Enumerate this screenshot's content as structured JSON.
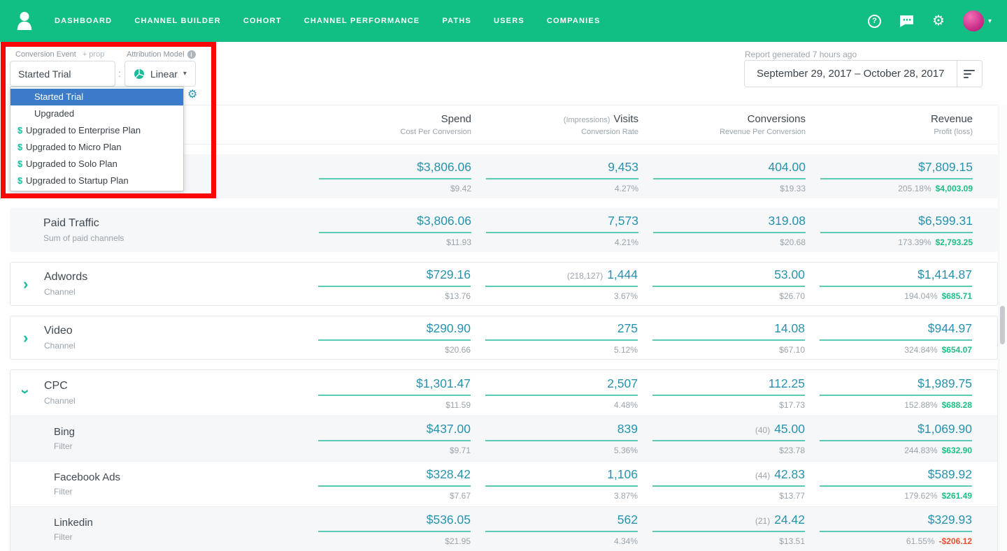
{
  "colors": {
    "nav_green": "#11BE83",
    "value_teal": "#2892AE",
    "underline_teal": "#5CC9B5",
    "profit_green": "#1DBE84",
    "negative_red": "#E8502F",
    "selected_blue": "#3B7BC8",
    "annotation_red": "#F90606"
  },
  "nav": {
    "items": [
      "DASHBOARD",
      "CHANNEL BUILDER",
      "COHORT",
      "CHANNEL PERFORMANCE",
      "PATHS",
      "USERS",
      "COMPANIES"
    ],
    "icons": [
      "help-icon",
      "chat-icon",
      "gear-icon",
      "avatar"
    ]
  },
  "controls": {
    "conversion_event_label": "Conversion Event",
    "prop_link": "+ prop",
    "attribution_model_label": "Attribution Model",
    "conversion_event_value": "Started Trial",
    "separator": ":",
    "attribution_model_value": "Linear",
    "conversion_options": [
      {
        "prefix": "",
        "label": "Started Trial"
      },
      {
        "prefix": "",
        "label": "Upgraded"
      },
      {
        "prefix": "$",
        "label": "Upgraded to Enterprise Plan"
      },
      {
        "prefix": "$",
        "label": "Upgraded to Micro Plan"
      },
      {
        "prefix": "$",
        "label": "Upgraded to Solo Plan"
      },
      {
        "prefix": "$",
        "label": "Upgraded to Startup Plan"
      }
    ]
  },
  "report": {
    "generated": "Report generated 7 hours ago",
    "date_range": "September 29, 2017 – October 28, 2017"
  },
  "table": {
    "columns": [
      {
        "pre": "",
        "main": "Spend",
        "sub": "Cost Per Conversion"
      },
      {
        "pre": "(Impressions)",
        "main": "Visits",
        "sub": "Conversion Rate"
      },
      {
        "pre": "",
        "main": "Conversions",
        "sub": "Revenue Per Conversion"
      },
      {
        "pre": "",
        "main": "Revenue",
        "sub": "Profit (loss)"
      }
    ],
    "rows": [
      {
        "name": "",
        "sub": "",
        "spend": "$3,806.06",
        "spend_sub": "$9.42",
        "visits_pre": "",
        "visits": "9,453",
        "visits_sub": "4.27%",
        "conv_pre": "",
        "conv": "404.00",
        "conv_sub": "$19.33",
        "revenue": "$7,809.15",
        "profit_pct": "205.18%",
        "profit": "$4,003.09"
      },
      {
        "name": "Paid Traffic",
        "sub": "Sum of paid channels",
        "spend": "$3,806.06",
        "spend_sub": "$11.93",
        "visits_pre": "",
        "visits": "7,573",
        "visits_sub": "4.21%",
        "conv_pre": "",
        "conv": "319.08",
        "conv_sub": "$20.68",
        "revenue": "$6,599.31",
        "profit_pct": "173.39%",
        "profit": "$2,793.25"
      },
      {
        "name": "Adwords",
        "sub": "Channel",
        "spend": "$729.16",
        "spend_sub": "$13.76",
        "visits_pre": "(218,127)",
        "visits": "1,444",
        "visits_sub": "3.67%",
        "conv_pre": "",
        "conv": "53.00",
        "conv_sub": "$26.70",
        "revenue": "$1,414.87",
        "profit_pct": "194.04%",
        "profit": "$685.71"
      },
      {
        "name": "Video",
        "sub": "Channel",
        "spend": "$290.90",
        "spend_sub": "$20.66",
        "visits_pre": "",
        "visits": "275",
        "visits_sub": "5.12%",
        "conv_pre": "",
        "conv": "14.08",
        "conv_sub": "$67.10",
        "revenue": "$944.97",
        "profit_pct": "324.84%",
        "profit": "$654.07"
      },
      {
        "name": "CPC",
        "sub": "Channel",
        "spend": "$1,301.47",
        "spend_sub": "$11.59",
        "visits_pre": "",
        "visits": "2,507",
        "visits_sub": "4.48%",
        "conv_pre": "",
        "conv": "112.25",
        "conv_sub": "$17.73",
        "revenue": "$1,989.75",
        "profit_pct": "152.88%",
        "profit": "$688.28"
      },
      {
        "name": "Bing",
        "sub": "Filter",
        "spend": "$437.00",
        "spend_sub": "$9.71",
        "visits_pre": "",
        "visits": "839",
        "visits_sub": "5.36%",
        "conv_pre": "(40)",
        "conv": "45.00",
        "conv_sub": "$23.78",
        "revenue": "$1,069.90",
        "profit_pct": "244.83%",
        "profit": "$632.90"
      },
      {
        "name": "Facebook Ads",
        "sub": "Filter",
        "spend": "$328.42",
        "spend_sub": "$7.67",
        "visits_pre": "",
        "visits": "1,106",
        "visits_sub": "3.87%",
        "conv_pre": "(44)",
        "conv": "42.83",
        "conv_sub": "$13.77",
        "revenue": "$589.92",
        "profit_pct": "179.62%",
        "profit": "$261.49"
      },
      {
        "name": "Linkedin",
        "sub": "Filter",
        "spend": "$536.05",
        "spend_sub": "$21.95",
        "visits_pre": "",
        "visits": "562",
        "visits_sub": "4.34%",
        "conv_pre": "(21)",
        "conv": "24.42",
        "conv_sub": "$13.51",
        "revenue": "$329.93",
        "profit_pct": "61.55%",
        "profit": "-$206.12"
      }
    ]
  }
}
